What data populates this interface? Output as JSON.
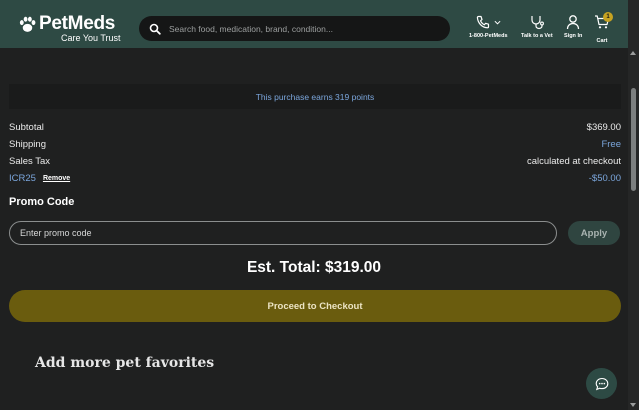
{
  "header": {
    "brand": "PetMeds",
    "tagline": "Care You Trust",
    "search_placeholder": "Search food, medication, brand, condition...",
    "nav": {
      "phone_label": "1-800-PetMeds",
      "vet_label": "Talk to a Vet",
      "signin_label": "Sign In",
      "cart_label": "Cart",
      "cart_count": "1"
    }
  },
  "summary": {
    "points_text": "This purchase earns 319 points",
    "subtotal_label": "Subtotal",
    "subtotal_value": "$369.00",
    "shipping_label": "Shipping",
    "shipping_value": "Free",
    "tax_label": "Sales Tax",
    "tax_value": "calculated at checkout",
    "coupon_code": "ICR25",
    "coupon_remove": "Remove",
    "coupon_value": "-$50.00"
  },
  "promo": {
    "title": "Promo Code",
    "placeholder": "Enter promo code",
    "apply_label": "Apply"
  },
  "total": {
    "text": "Est. Total: $319.00"
  },
  "checkout": {
    "label": "Proceed to Checkout"
  },
  "favorites": {
    "title": "Add more pet favorites"
  },
  "colors": {
    "header_bg": "#2e4a44",
    "page_bg": "#1f2020",
    "accent_blue": "#7ba6dc",
    "checkout_bg": "#6a5c0e",
    "badge": "#c7a321"
  },
  "icons": [
    "paw-icon",
    "search-icon",
    "phone-icon",
    "chevron-down-icon",
    "stethoscope-icon",
    "user-icon",
    "cart-icon",
    "chat-icon"
  ]
}
